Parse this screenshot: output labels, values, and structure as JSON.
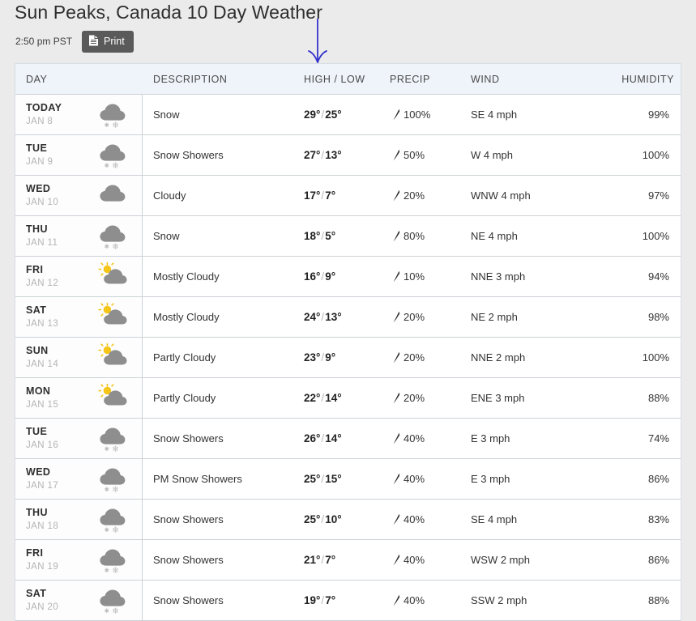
{
  "header": {
    "title": "Sun Peaks, Canada 10 Day Weather",
    "local_time": "2:50 pm PST",
    "print_label": "Print",
    "print_icon": "document-icon"
  },
  "annotation": {
    "type": "down-arrow",
    "color": "#3333cc",
    "points_at": "HIGH / LOW"
  },
  "table": {
    "columns": [
      {
        "key": "day",
        "label": "DAY"
      },
      {
        "key": "description",
        "label": "DESCRIPTION"
      },
      {
        "key": "temp",
        "label": "HIGH / LOW"
      },
      {
        "key": "precip",
        "label": "PRECIP"
      },
      {
        "key": "wind",
        "label": "WIND"
      },
      {
        "key": "humidity",
        "label": "HUMIDITY"
      }
    ],
    "rows": [
      {
        "day_name": "TODAY",
        "day_date": "JAN 8",
        "icon": "snow-icon",
        "description": "Snow",
        "high": "29°",
        "low": "25°",
        "precip": "100%",
        "wind": "SE 4 mph",
        "humidity": "99%"
      },
      {
        "day_name": "TUE",
        "day_date": "JAN 9",
        "icon": "snow-icon",
        "description": "Snow Showers",
        "high": "27°",
        "low": "13°",
        "precip": "50%",
        "wind": "W 4 mph",
        "humidity": "100%"
      },
      {
        "day_name": "WED",
        "day_date": "JAN 10",
        "icon": "cloudy-icon",
        "description": "Cloudy",
        "high": "17°",
        "low": "7°",
        "precip": "20%",
        "wind": "WNW 4 mph",
        "humidity": "97%"
      },
      {
        "day_name": "THU",
        "day_date": "JAN 11",
        "icon": "snow-icon",
        "description": "Snow",
        "high": "18°",
        "low": "5°",
        "precip": "80%",
        "wind": "NE 4 mph",
        "humidity": "100%"
      },
      {
        "day_name": "FRI",
        "day_date": "JAN 12",
        "icon": "sun-behind-cloud-icon",
        "description": "Mostly Cloudy",
        "high": "16°",
        "low": "9°",
        "precip": "10%",
        "wind": "NNE 3 mph",
        "humidity": "94%"
      },
      {
        "day_name": "SAT",
        "day_date": "JAN 13",
        "icon": "sun-behind-cloud-icon",
        "description": "Mostly Cloudy",
        "high": "24°",
        "low": "13°",
        "precip": "20%",
        "wind": "NE 2 mph",
        "humidity": "98%"
      },
      {
        "day_name": "SUN",
        "day_date": "JAN 14",
        "icon": "sun-behind-cloud-icon",
        "description": "Partly Cloudy",
        "high": "23°",
        "low": "9°",
        "precip": "20%",
        "wind": "NNE 2 mph",
        "humidity": "100%"
      },
      {
        "day_name": "MON",
        "day_date": "JAN 15",
        "icon": "sun-behind-cloud-icon",
        "description": "Partly Cloudy",
        "high": "22°",
        "low": "14°",
        "precip": "20%",
        "wind": "ENE 3 mph",
        "humidity": "88%"
      },
      {
        "day_name": "TUE",
        "day_date": "JAN 16",
        "icon": "snow-icon",
        "description": "Snow Showers",
        "high": "26°",
        "low": "14°",
        "precip": "40%",
        "wind": "E 3 mph",
        "humidity": "74%"
      },
      {
        "day_name": "WED",
        "day_date": "JAN 17",
        "icon": "snow-icon",
        "description": "PM Snow Showers",
        "high": "25°",
        "low": "15°",
        "precip": "40%",
        "wind": "E 3 mph",
        "humidity": "86%"
      },
      {
        "day_name": "THU",
        "day_date": "JAN 18",
        "icon": "snow-icon",
        "description": "Snow Showers",
        "high": "25°",
        "low": "10°",
        "precip": "40%",
        "wind": "SE 4 mph",
        "humidity": "83%"
      },
      {
        "day_name": "FRI",
        "day_date": "JAN 19",
        "icon": "snow-icon",
        "description": "Snow Showers",
        "high": "21°",
        "low": "7°",
        "precip": "40%",
        "wind": "WSW 2 mph",
        "humidity": "86%"
      },
      {
        "day_name": "SAT",
        "day_date": "JAN 20",
        "icon": "snow-icon",
        "description": "Snow Showers",
        "high": "19°",
        "low": "7°",
        "precip": "40%",
        "wind": "SSW 2 mph",
        "humidity": "88%"
      }
    ]
  },
  "colors": {
    "page_background": "#ebebeb",
    "header_row": "#eef4fa",
    "cloud_gray": "#8e8e8e",
    "sun_yellow": "#f5c518",
    "annotation_blue": "#3333cc"
  }
}
